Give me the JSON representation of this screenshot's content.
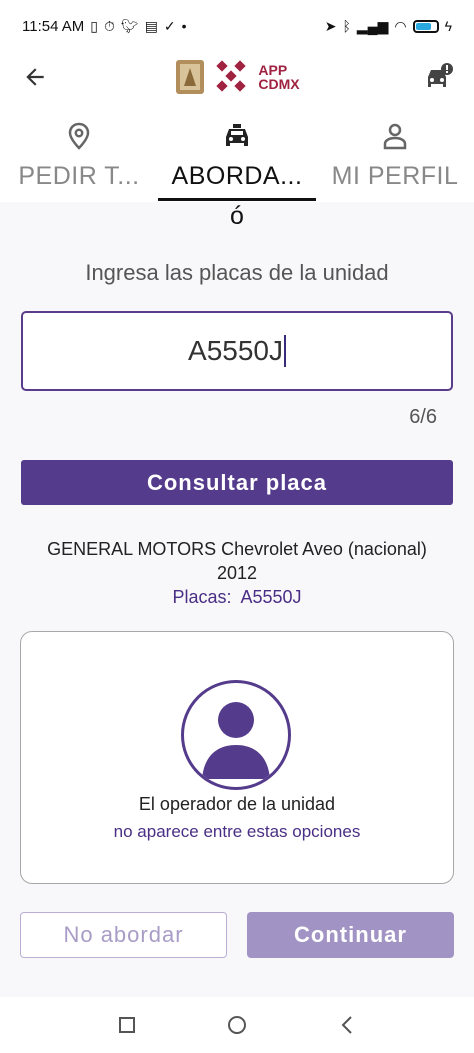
{
  "status_bar": {
    "time": "11:54 AM",
    "icons": [
      "vibrate-icon",
      "alarm-icon",
      "twitter-icon",
      "message-icon",
      "check-icon",
      "dot-icon",
      "location-icon",
      "bluetooth-icon",
      "signal-icon",
      "signal-icon",
      "wifi-icon",
      "battery-icon",
      "charging-icon"
    ]
  },
  "app_bar": {
    "logo_text_line1": "APP",
    "logo_text_line2": "CDMX",
    "brand_color": "#9f2241"
  },
  "tabs": [
    {
      "label": "PEDIR T...",
      "icon": "location-pin-icon",
      "active": false
    },
    {
      "label": "ABORDA...",
      "icon": "taxi-icon",
      "active": true
    },
    {
      "label": "MI PERFIL",
      "icon": "person-icon",
      "active": false
    }
  ],
  "content": {
    "stray_char": "ó",
    "prompt": "Ingresa las placas de la unidad",
    "plate_value": "A5550J",
    "counter": "6/6",
    "consult_button": "Consultar placa",
    "vehicle_line1": "GENERAL MOTORS Chevrolet Aveo (nacional)",
    "vehicle_line2": "2012",
    "plates_label": "Placas:",
    "plates_value": "A5550J",
    "operator_title": "El operador de la unidad",
    "operator_link": "no aparece entre estas opciones",
    "btn_no": "No abordar",
    "btn_continue": "Continuar"
  },
  "colors": {
    "primary": "#553b8c",
    "primary_disabled": "#a194c4",
    "text_accent": "#4a2f86"
  }
}
